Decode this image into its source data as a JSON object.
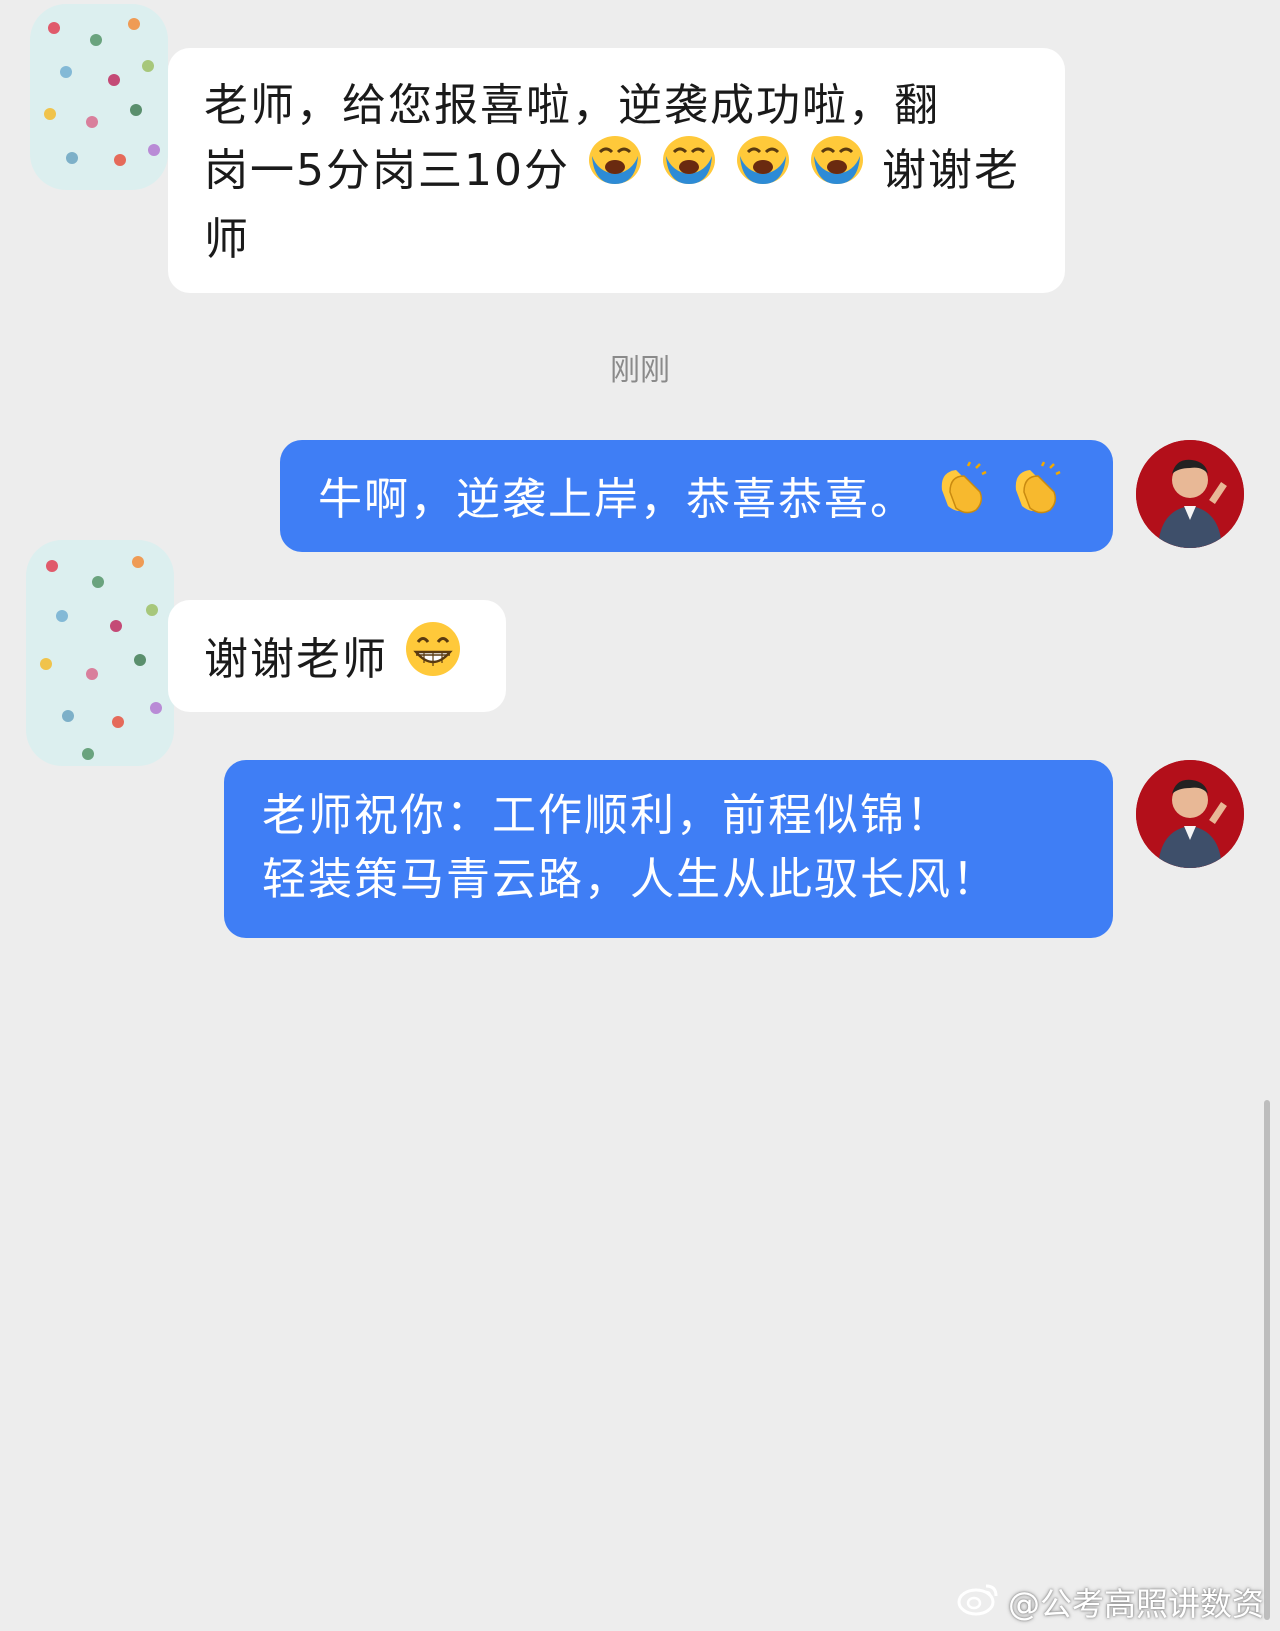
{
  "messages": [
    {
      "side": "incoming",
      "text_line1": "老师，给您报喜啦，逆袭成功啦，翻",
      "text_line2_a": "岗一5分岗三10分",
      "text_line2_b": "谢谢老",
      "text_line3": "师",
      "emoji": "loudly-crying-face-icon"
    },
    {
      "side": "outgoing",
      "text": "牛啊，逆袭上岸，恭喜恭喜。",
      "emoji": "clapping-hands-icon"
    },
    {
      "side": "incoming",
      "text": "谢谢老师",
      "emoji": "grinning-face-icon"
    },
    {
      "side": "outgoing",
      "text_line1": "老师祝你：工作顺利，前程似锦！",
      "text_line2": "轻装策马青云路，人生从此驭长风！"
    }
  ],
  "timestamp": "刚刚",
  "watermark": "@公考高照讲数资",
  "colors": {
    "background": "#ededed",
    "incoming_bubble": "#ffffff",
    "outgoing_bubble": "#3f7ef5",
    "teacher_avatar_bg": "#b30f1a"
  }
}
